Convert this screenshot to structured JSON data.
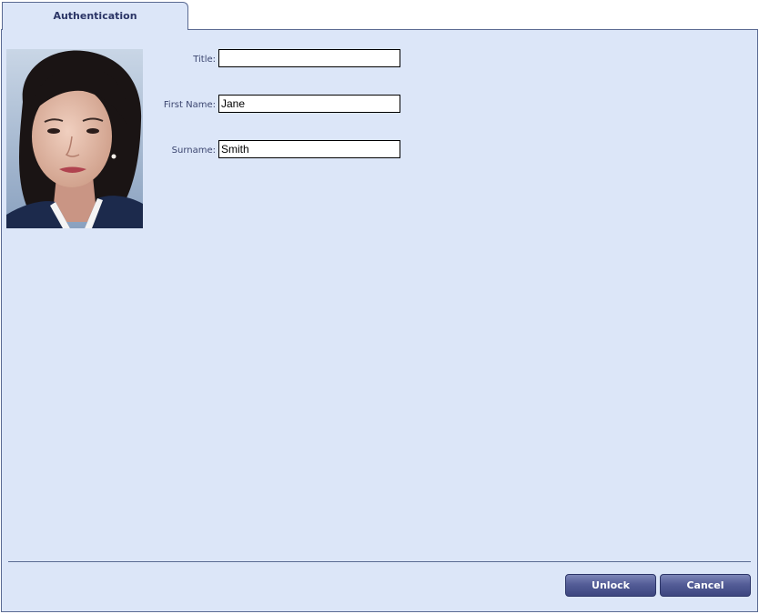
{
  "tabs": [
    {
      "label": "Authentication"
    }
  ],
  "photo": {
    "icon": "person-photo",
    "colors": {
      "background": "#9fb3cd",
      "hair": "#1a1414",
      "skin": "#e0b8a4",
      "jacket": "#1c2a4c"
    }
  },
  "form": {
    "title": {
      "label": "Title:",
      "value": ""
    },
    "first_name": {
      "label": "First Name:",
      "value": "Jane"
    },
    "surname": {
      "label": "Surname:",
      "value": "Smith"
    }
  },
  "buttons": {
    "unlock": "Unlock",
    "cancel": "Cancel"
  },
  "colors": {
    "panel_bg": "#dce6f8",
    "border": "#5a6a92",
    "tab_text": "#2b3566",
    "button_bg": "#545d97"
  }
}
